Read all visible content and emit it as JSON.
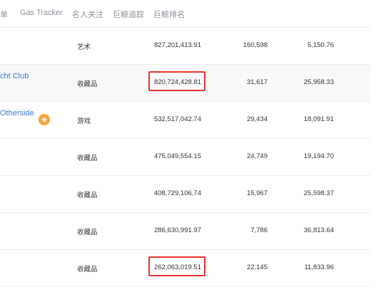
{
  "nav": {
    "items": [
      "榜单",
      "Gas Tracker",
      "名人关注",
      "巨鲸追踪",
      "巨鲸排名"
    ],
    "first_visible": "单"
  },
  "table": {
    "rows": [
      {
        "name": "",
        "category": "艺术",
        "volume": "827,201,413.91",
        "trades": "160,598",
        "avg": "5,150.76",
        "highlight": false,
        "alt": false
      },
      {
        "name": "cht Club",
        "category": "收藏品",
        "volume": "820,724,428.81",
        "trades": "31,617",
        "avg": "25,958.33",
        "highlight": true,
        "alt": true
      },
      {
        "name": "Otherside",
        "category": "游戏",
        "volume": "532,517,042.74",
        "trades": "29,434",
        "avg": "18,091.91",
        "highlight": false,
        "alt": false,
        "badge": true
      },
      {
        "name": "",
        "category": "收藏品",
        "volume": "475,049,554.15",
        "trades": "24,749",
        "avg": "19,194.70",
        "highlight": false,
        "alt": false
      },
      {
        "name": "",
        "category": "收藏品",
        "volume": "408,729,106.74",
        "trades": "15,967",
        "avg": "25,598.37",
        "highlight": false,
        "alt": false
      },
      {
        "name": "",
        "category": "收藏品",
        "volume": "286,630,991.97",
        "trades": "7,786",
        "avg": "36,813.64",
        "highlight": false,
        "alt": false
      },
      {
        "name": "",
        "category": "收藏品",
        "volume": "262,063,019.51",
        "trades": "22,145",
        "avg": "11,833.96",
        "highlight": true,
        "alt": false
      }
    ]
  },
  "colors": {
    "link": "#3a7bd5",
    "highlight_border": "#e8322b",
    "badge": "#f7a23b"
  },
  "icons": {
    "badge": "new-badge-icon"
  }
}
